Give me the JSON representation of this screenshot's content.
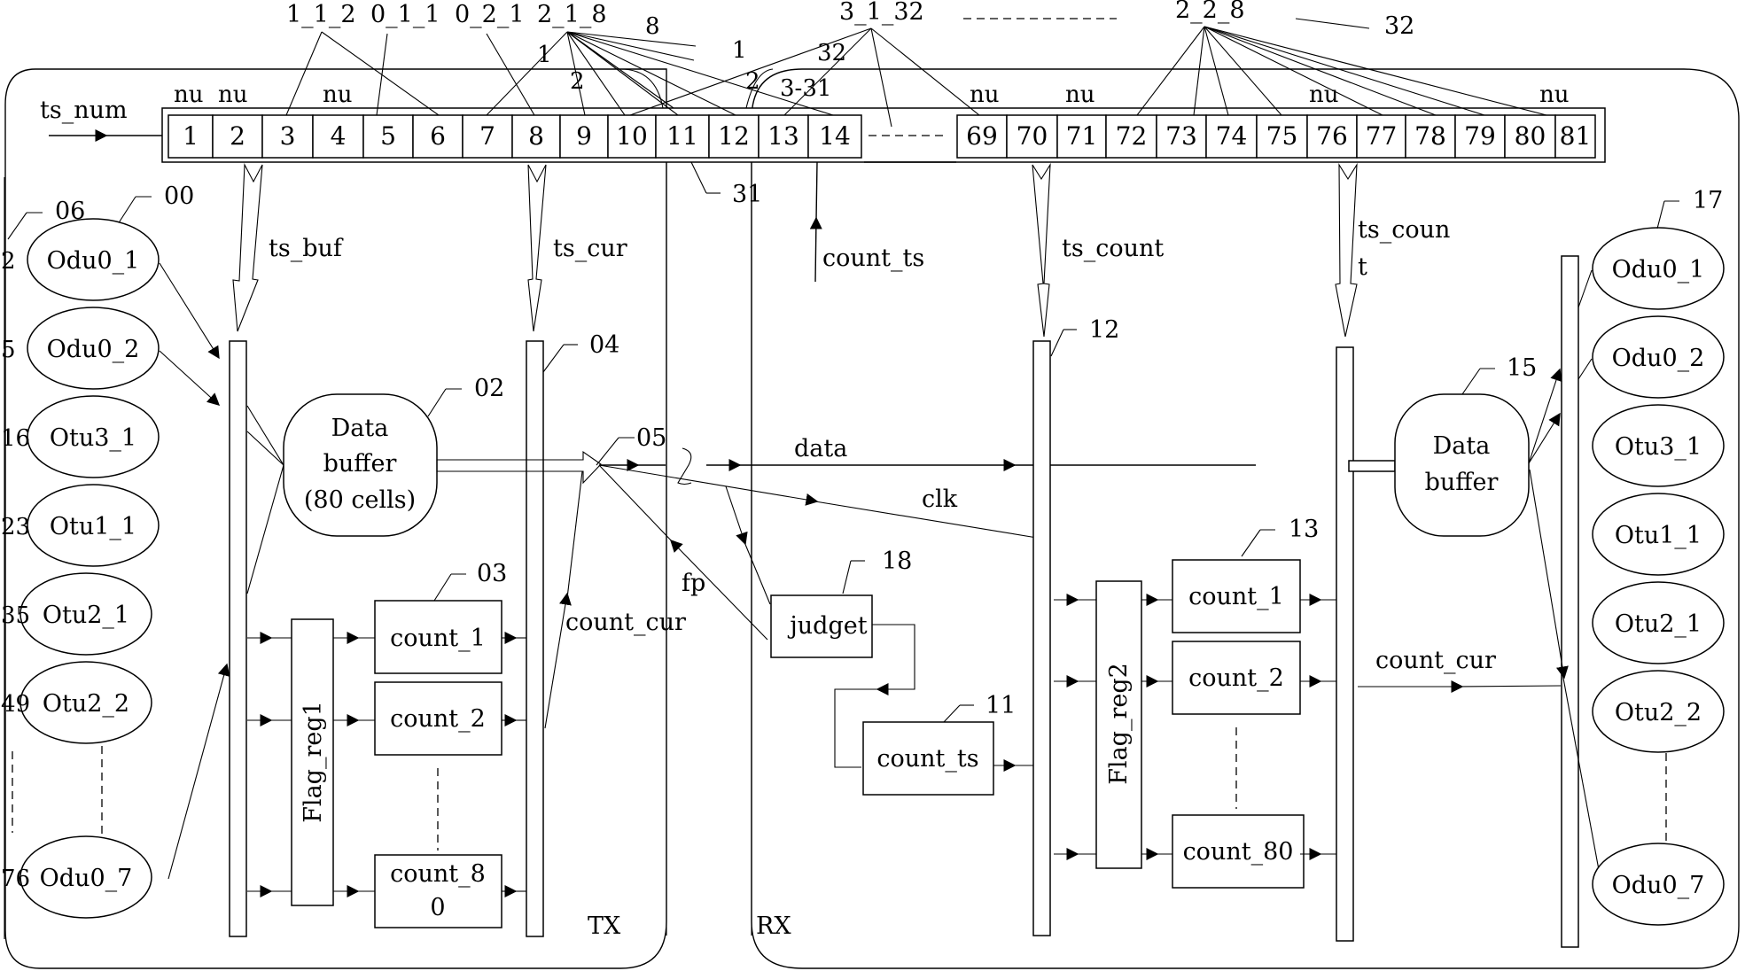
{
  "figure": {
    "sections": {
      "tx": "TX",
      "rx": "RX"
    },
    "input_label": "ts_num",
    "timeslot_cells_left": [
      "1",
      "2",
      "3",
      "4",
      "5",
      "6",
      "7",
      "8",
      "9",
      "10",
      "11",
      "12",
      "13",
      "14"
    ],
    "timeslot_cells_right": [
      "69",
      "70",
      "71",
      "72",
      "73",
      "74",
      "75",
      "76",
      "77",
      "78",
      "79",
      "80",
      "81"
    ],
    "nu_labels": [
      "nu",
      "nu",
      "nu",
      "nu",
      "nu",
      "nu",
      "nu"
    ],
    "mapping_labels": {
      "m112": "1_1_2",
      "m011": "0_1_1",
      "m021": "0_2_1",
      "m218": "2_1_8",
      "m218_8": "8",
      "m218_1": "1",
      "m218_2": "2",
      "m3132": "3_1_32",
      "m3132_1": "1",
      "m3132_2": "2",
      "m3132_331": "3-31",
      "m3132_32": "32",
      "m228": "2_2_8",
      "ref32": "32",
      "ref31": "31"
    },
    "tx": {
      "ellipses": [
        {
          "label": "Odu0_1",
          "slot": "2"
        },
        {
          "label": "Odu0_2",
          "slot": "5"
        },
        {
          "label": "Otu3_1",
          "slot": "16"
        },
        {
          "label": "Otu1_1",
          "slot": "23"
        },
        {
          "label": "Otu2_1",
          "slot": "35"
        },
        {
          "label": "Otu2_2",
          "slot": "49"
        },
        {
          "label": "Odu0_7",
          "slot": "76"
        }
      ],
      "refs": {
        "ellipse_group": "00",
        "slot_col": "06",
        "data_buffer": "02",
        "counters": "03",
        "bus": "04",
        "mux": "05"
      },
      "ts_buf": "ts_buf",
      "ts_cur": "ts_cur",
      "data_buffer": [
        "Data",
        "buffer",
        "(80 cells)"
      ],
      "flag_reg": "Flag_reg1",
      "counters": [
        "count_1",
        "count_2",
        "count_8",
        "0"
      ],
      "count_cur": "count_cur"
    },
    "link": {
      "data": "data",
      "clk": "clk",
      "fp": "fp",
      "count_ts": "count_ts"
    },
    "rx": {
      "refs": {
        "judget": "18",
        "count_ts": "11",
        "bus": "12",
        "counters": "13",
        "data_buffer": "15",
        "ellipse_group": "17"
      },
      "judget": "judget",
      "count_ts_box": "count_ts",
      "ts_count": "ts_count",
      "ts_coun": "ts_coun",
      "ts_coun_t": "t",
      "flag_reg": "Flag_reg2",
      "counters": [
        "count_1",
        "count_2",
        "count_80"
      ],
      "count_cur": "count_cur",
      "data_buffer": [
        "Data",
        "buffer"
      ],
      "ellipses": [
        "Odu0_1",
        "Odu0_2",
        "Otu3_1",
        "Otu1_1",
        "Otu2_1",
        "Otu2_2",
        "Odu0_7"
      ],
      "dots": "-----------------"
    }
  }
}
